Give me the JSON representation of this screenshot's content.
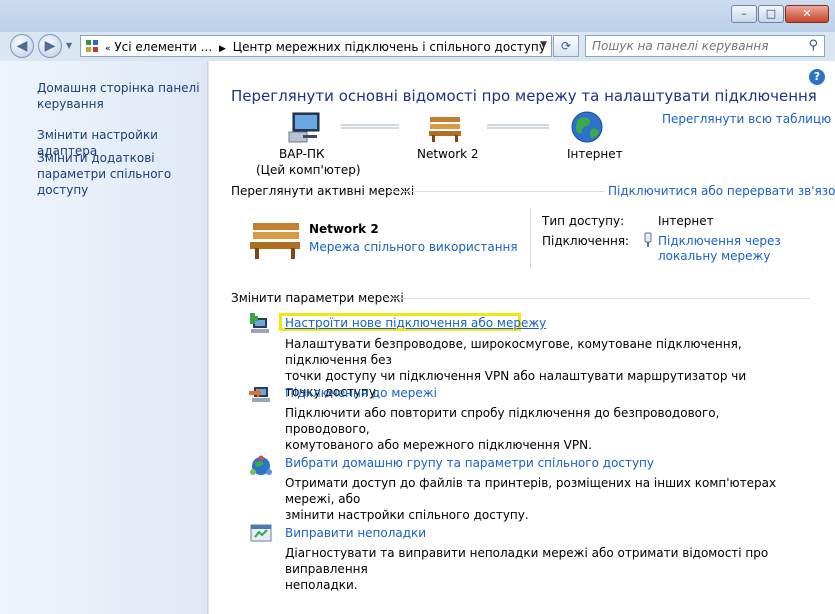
{
  "window": {
    "min": "–",
    "max": "□",
    "close": "✕"
  },
  "nav": {
    "back": "◀",
    "forward": "▶",
    "breadcrumb_1": "Усі елементи ...",
    "breadcrumb_2": "Центр мережних підключень і спільного доступу",
    "search_placeholder": "Пошук на панелі керування"
  },
  "sidebar": {
    "home": "Домашня сторінка панелі керування",
    "adapter": "Змінити настройки адаптера",
    "sharing": "Змінити додаткові параметри спільного доступу"
  },
  "main": {
    "title": "Переглянути основні відомості про мережу та налаштувати підключення",
    "view_full_map": "Переглянути всю таблицю",
    "map": {
      "pc_name": "ВАР-ПК",
      "pc_sub": "(Цей комп'ютер)",
      "network": "Network 2",
      "internet": "Інтернет"
    },
    "active": {
      "heading": "Переглянути активні мережі",
      "connect_link": "Підключитися або перервати зв'язок",
      "network_name": "Network 2",
      "network_type": "Мережа спільного використання",
      "access_label": "Тип доступу:",
      "access_value": "Інтернет",
      "conn_label": "Підключення:",
      "conn_value_1": "Підключення через",
      "conn_value_2": "локальну мережу"
    },
    "change": {
      "heading": "Змінити параметри мережі",
      "items": [
        {
          "title": "Настроїти нове підключення або мережу",
          "desc1": "Налаштувати безпроводове, широкосмугове, комутоване підключення, підключення без",
          "desc2": "точки доступу чи підключення VPN або налаштувати маршрутизатор чи точку доступу."
        },
        {
          "title": "Підключення до мережі",
          "desc1": "Підключити або повторити спробу підключення до безпроводового, проводового,",
          "desc2": "комутованого або мережного підключення VPN."
        },
        {
          "title": "Вибрати домашню групу та параметри спільного доступу",
          "desc1": "Отримати доступ до файлів та принтерів, розміщених на інших комп'ютерах мережі, або",
          "desc2": "змінити настройки спільного доступу."
        },
        {
          "title": "Виправити неполадки",
          "desc1": "Діагностувати та виправити неполадки мережі або отримати відомості про виправлення",
          "desc2": "неполадки."
        }
      ]
    }
  }
}
